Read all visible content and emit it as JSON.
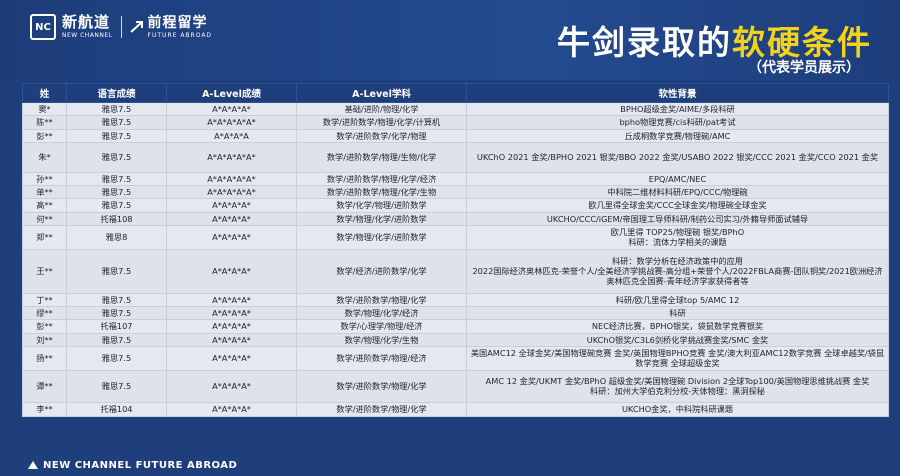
{
  "header": {
    "logo_mark": "NC",
    "brand1_cn": "新航道",
    "brand1_en": "NEW CHANNEL",
    "brand2_cn": "前程留学",
    "brand2_en": "FUTURE ABROAD",
    "title_part1": "牛剑录取的",
    "title_highlight": "软硬条件",
    "subtitle": "（代表学员展示）"
  },
  "table": {
    "headers": [
      "姓",
      "语言成绩",
      "A-Level成绩",
      "A-Level学科",
      "软性背景"
    ],
    "rows": [
      {
        "name": "窦*",
        "lang": "雅思7.5",
        "grade": "A*A*A*A*",
        "subjects": "基础/进阶/物理/化学",
        "bg": "BPHO超级金奖/AIME/多段科研"
      },
      {
        "name": "陈**",
        "lang": "雅思7.5",
        "grade": "A*A*A*A*A*",
        "subjects": "数学/进阶数学/物理/化学/计算机",
        "bg": "bpho物理竞赛/cis科研/pat考试"
      },
      {
        "name": "彭**",
        "lang": "雅思7.5",
        "grade": "A*A*A*A",
        "subjects": "数学/进阶数学/化学/物理",
        "bg": "丘成桐数学竞赛/物理碗/AMC"
      },
      {
        "name": "朱*",
        "lang": "雅思7.5",
        "grade": "A*A*A*A*A*",
        "subjects": "数学/进阶数学/物理/生物/化学",
        "bg": "UKChO 2021 金奖/BPHO 2021 银奖/BBO 2022 金奖/USABO 2022 银奖/CCC 2021 金奖/CCO 2021 金奖"
      },
      {
        "name": "孙**",
        "lang": "雅思7.5",
        "grade": "A*A*A*A*A*",
        "subjects": "数学/进阶数学/物理/化学/经济",
        "bg": "EPQ/AMC/NEC"
      },
      {
        "name": "单**",
        "lang": "雅思7.5",
        "grade": "A*A*A*A*A*",
        "subjects": "数学/进阶数学/物理/化学/生物",
        "bg": "中科院二维材料科研/EPQ/CCC/物理碗"
      },
      {
        "name": "高**",
        "lang": "雅思7.5",
        "grade": "A*A*A*A*",
        "subjects": "数学/化学/物理/进阶数学",
        "bg": "欧几里得全球金奖/CCC全球金奖/物理碗全球金奖"
      },
      {
        "name": "何**",
        "lang": "托福108",
        "grade": "A*A*A*A*",
        "subjects": "数学/物理/化学/进阶数学",
        "bg": "UKCHO/CCC/iGEM/帝国理工导师科研/制药公司实习/外籍导师面试辅导"
      },
      {
        "name": "郑**",
        "lang": "雅思8",
        "grade": "A*A*A*A*",
        "subjects": "数学/物理/化学/进阶数学",
        "bg": "欧几里得 TOP25/物理碗 银奖/BPhO\n科研：流体力学相关的课题"
      },
      {
        "name": "王**",
        "lang": "雅思7.5",
        "grade": "A*A*A*A*",
        "subjects": "数学/经济/进阶数学/化学",
        "bg": "科研：数学分析在经济政策中的应用\n2022国际经济奥林匹克-荣誉个人/全美经济学挑战赛-高分组+荣誉个人/2022FBLA商赛-团队铜奖/2021欧洲经济奥林匹克全国赛-青年经济学家获得者等"
      },
      {
        "name": "丁**",
        "lang": "雅思7.5",
        "grade": "A*A*A*A*",
        "subjects": "数学/进阶数学/物理/化学",
        "bg": "科研/欧几里得全球top 5/AMC 12"
      },
      {
        "name": "缪**",
        "lang": "雅思7.5",
        "grade": "A*A*A*A*",
        "subjects": "数学/物理/化学/经济",
        "bg": "科研"
      },
      {
        "name": "彭**",
        "lang": "托福107",
        "grade": "A*A*A*A*",
        "subjects": "数学/心理学/物理/经济",
        "bg": "NEC经济比赛，BPHO银奖，袋鼠数学竞赛银奖"
      },
      {
        "name": "刘**",
        "lang": "雅思7.5",
        "grade": "A*A*A*A*",
        "subjects": "数学/物理/化学/生物",
        "bg": "UKChO银奖/C3L6剑桥化学挑战赛金奖/SMC 金奖"
      },
      {
        "name": "扬**",
        "lang": "雅思7.5",
        "grade": "A*A*A*A*",
        "subjects": "数学/进阶数学/物理/经济",
        "bg": "美国AMC12 全球金奖/美国物理碗竞赛 金奖/英国物理BPHO竞赛 金奖/澳大利亚AMC12数学竞赛 全球卓越奖/袋鼠数学竞赛 全球超级金奖"
      },
      {
        "name": "谭**",
        "lang": "雅思7.5",
        "grade": "A*A*A*A*",
        "subjects": "数学/进阶数学/物理/化学",
        "bg": "AMC 12 金奖/UKMT 金奖/BPhO 超级金奖/美国物理碗 Division 2全球Top100/英国物理思维挑战赛 金奖\n科研：加州大学伯克利分校-天体物理：黑洞探秘"
      },
      {
        "name": "李**",
        "lang": "托福104",
        "grade": "A*A*A*A*",
        "subjects": "数学/进阶数学/物理/化学",
        "bg": "UKCHO金奖，中科院科研课题"
      }
    ]
  },
  "footer": {
    "text": "NEW CHANNEL FUTURE ABROAD"
  },
  "colors": {
    "background": "#1f3f7c",
    "title_highlight": "#f3d21c",
    "row_bg": "#e6e8ef"
  }
}
